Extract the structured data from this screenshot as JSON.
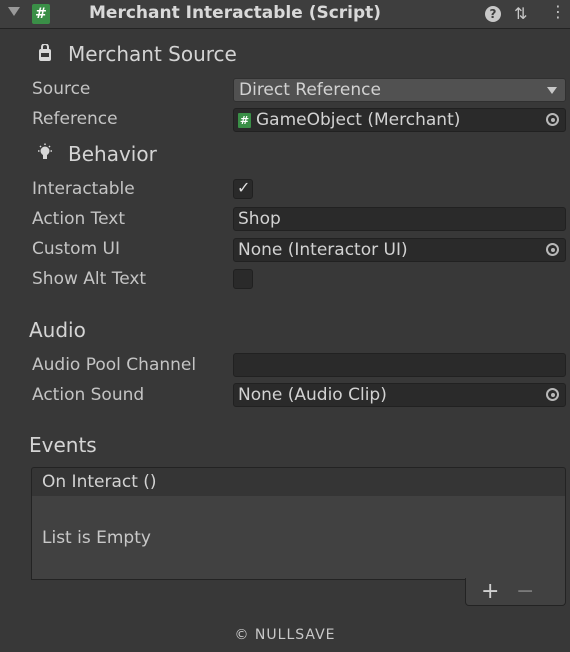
{
  "header": {
    "title": "Merchant Interactable (Script)",
    "script_icon_glyph": "#",
    "help_glyph": "?",
    "presets_glyph": "⇅",
    "menu_glyph": "⋮"
  },
  "merchant_source": {
    "heading": "Merchant Source",
    "source_label": "Source",
    "source_value": "Direct Reference",
    "reference_label": "Reference",
    "reference_value": "GameObject (Merchant)"
  },
  "behavior": {
    "heading": "Behavior",
    "interactable_label": "Interactable",
    "interactable_checked": true,
    "check_glyph": "✓",
    "action_text_label": "Action Text",
    "action_text_value": "Shop",
    "custom_ui_label": "Custom UI",
    "custom_ui_value": "None (Interactor UI)",
    "show_alt_text_label": "Show Alt Text",
    "show_alt_text_checked": false
  },
  "audio": {
    "heading": "Audio",
    "pool_channel_label": "Audio Pool Channel",
    "pool_channel_value": "",
    "action_sound_label": "Action Sound",
    "action_sound_value": "None (Audio Clip)"
  },
  "events": {
    "heading": "Events",
    "list_title": "On Interact ()",
    "empty_text": "List is Empty",
    "add_glyph": "+",
    "remove_glyph": "−"
  },
  "footer": {
    "text": "© NULLSAVE"
  },
  "colors": {
    "background": "#383838",
    "field": "#2a2a2a",
    "script_icon": "#3a8f47"
  }
}
